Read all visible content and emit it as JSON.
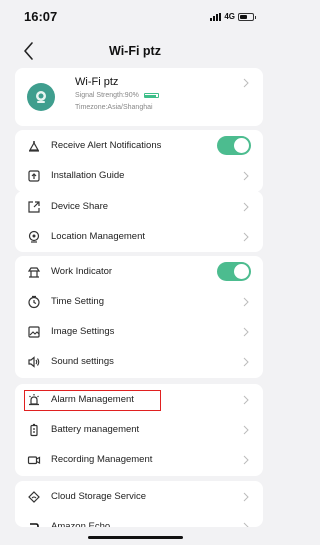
{
  "status_bar": {
    "time": "16:07",
    "network": "4G",
    "battery_level": 0.6
  },
  "nav": {
    "title": "Wi-Fi ptz"
  },
  "device": {
    "name": "Wi-Fi ptz",
    "signal_text": "Signal Strength:90%",
    "signal_level": 0.9,
    "timezone": "Timezone:Asia/Shanghai"
  },
  "sections": {
    "alerts": [
      {
        "label": "Receive Alert Notifications",
        "icon": "bell-icon",
        "toggle": true
      },
      {
        "label": "Installation Guide",
        "icon": "upload-icon"
      }
    ],
    "share": [
      {
        "label": "Device Share",
        "icon": "share-icon"
      },
      {
        "label": "Location Management",
        "icon": "location-pin-icon"
      }
    ],
    "device_settings": [
      {
        "label": "Work Indicator",
        "icon": "indicator-icon",
        "toggle": true
      },
      {
        "label": "Time Setting",
        "icon": "clock-icon"
      },
      {
        "label": "Image Settings",
        "icon": "image-icon"
      },
      {
        "label": "Sound settings",
        "icon": "speaker-icon"
      }
    ],
    "management": [
      {
        "label": "Alarm Management",
        "icon": "alarm-icon"
      },
      {
        "label": "Battery management",
        "icon": "battery-icon"
      },
      {
        "label": "Recording Management",
        "icon": "video-camera-icon"
      }
    ],
    "services": [
      {
        "label": "Cloud Storage Service",
        "icon": "cloud-icon"
      },
      {
        "label": "Amazon Echo",
        "icon": "amazon-icon"
      }
    ]
  },
  "colors": {
    "accent": "#4cbc8f",
    "highlight": "#e02020",
    "background": "#f2f2f4"
  }
}
